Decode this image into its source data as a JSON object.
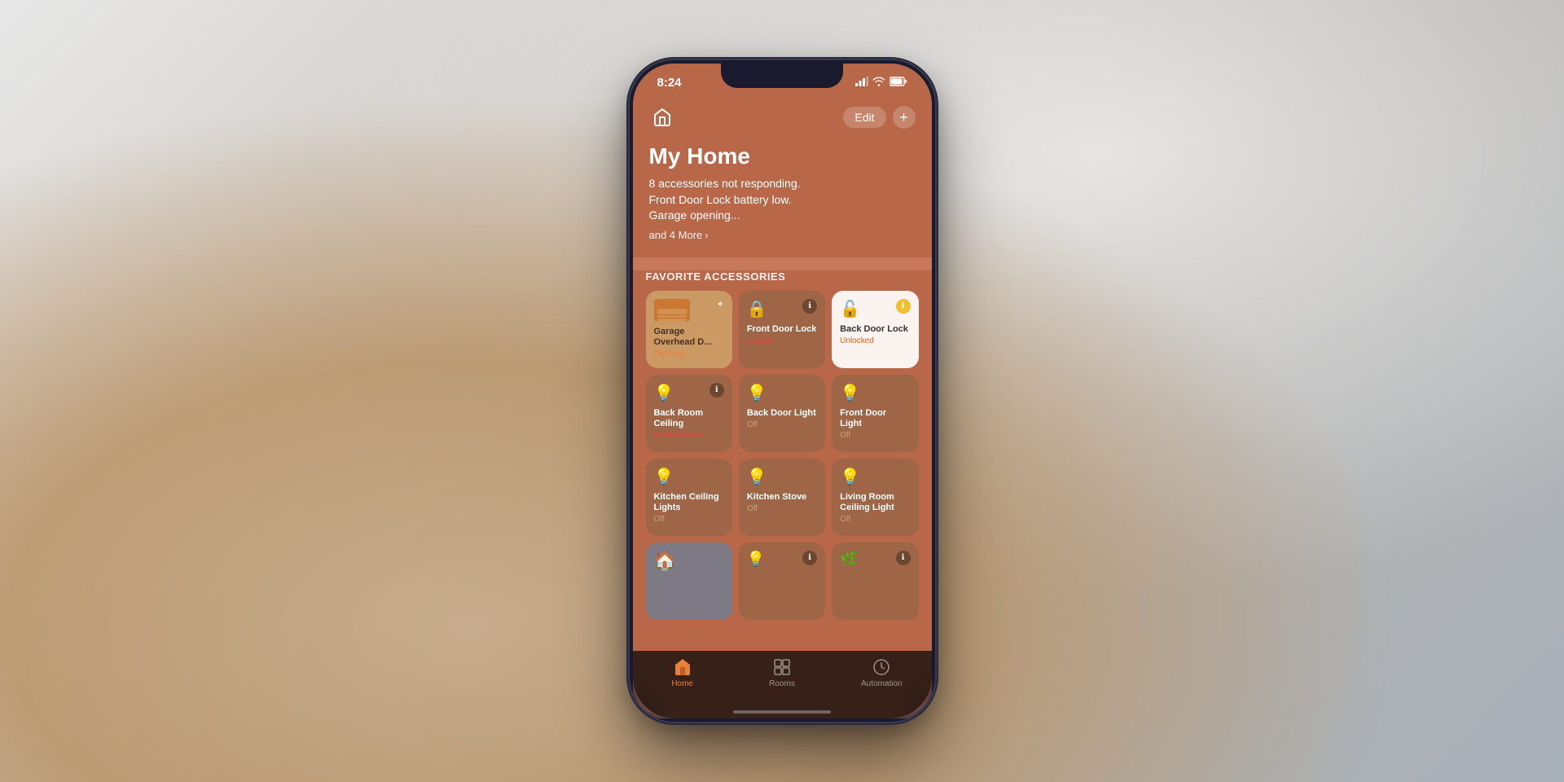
{
  "background": {
    "color": "#c0bcb8"
  },
  "phone": {
    "status_bar": {
      "time": "8:24",
      "signal": "●●●",
      "wifi": "wifi",
      "battery": "battery"
    },
    "header": {
      "title": "My Home",
      "alert_line1": "8 accessories not responding.",
      "alert_line2": "Front Door Lock battery low.",
      "alert_line3": "Garage opening...",
      "more_link": "and 4 More",
      "edit_button": "Edit",
      "add_button": "+"
    },
    "sections": [
      {
        "id": "favorite-accessories",
        "title": "Favorite Accessories"
      }
    ],
    "tiles": [
      {
        "id": "garage",
        "name": "Garage Overhead D...",
        "status": "Opening...",
        "status_class": "orange",
        "bg": "light",
        "icon": "🏠",
        "badge": false,
        "spinning": true
      },
      {
        "id": "front-door-lock",
        "name": "Front Door Lock",
        "status": "Locked",
        "status_class": "locked",
        "bg": "dark",
        "icon": "🔒",
        "badge": true
      },
      {
        "id": "back-door-lock",
        "name": "Back Door Lock",
        "status": "Unlocked",
        "status_class": "unlocked",
        "bg": "white",
        "icon": "🔓",
        "badge": true
      },
      {
        "id": "back-room-ceiling",
        "name": "Back Room Ceiling",
        "status": "No Response",
        "status_class": "red",
        "bg": "dark",
        "icon": "💡",
        "badge": true
      },
      {
        "id": "back-door-light",
        "name": "Back Door Light",
        "status": "Off",
        "status_class": "off",
        "bg": "dark",
        "icon": "💡",
        "badge": false
      },
      {
        "id": "front-door-light",
        "name": "Front Door Light",
        "status": "Off",
        "status_class": "off",
        "bg": "dark",
        "icon": "💡",
        "badge": false
      },
      {
        "id": "kitchen-ceiling",
        "name": "Kitchen Ceiling Lights",
        "status": "Off",
        "status_class": "off",
        "bg": "dark",
        "icon": "💡",
        "badge": false
      },
      {
        "id": "kitchen-stove",
        "name": "Kitchen Stove",
        "status": "Off",
        "status_class": "off",
        "bg": "dark",
        "icon": "💡",
        "badge": false
      },
      {
        "id": "living-room-ceiling",
        "name": "Living Room Ceiling Light",
        "status": "Off",
        "status_class": "off",
        "bg": "dark",
        "icon": "💡",
        "badge": false
      },
      {
        "id": "partial-1",
        "name": "...",
        "status": "",
        "bg": "blue-partial",
        "icon": "🏠"
      },
      {
        "id": "partial-2",
        "name": "...",
        "status": "",
        "bg": "dark-partial",
        "icon": "💡",
        "badge": true
      },
      {
        "id": "partial-3",
        "name": "...",
        "status": "",
        "bg": "dark-partial",
        "icon": "🌿",
        "badge": true
      }
    ],
    "tab_bar": {
      "tabs": [
        {
          "id": "home",
          "label": "Home",
          "icon": "🏠",
          "active": true
        },
        {
          "id": "rooms",
          "label": "Rooms",
          "icon": "⊞",
          "active": false
        },
        {
          "id": "automation",
          "label": "Automation",
          "icon": "⏱",
          "active": false
        }
      ]
    }
  }
}
